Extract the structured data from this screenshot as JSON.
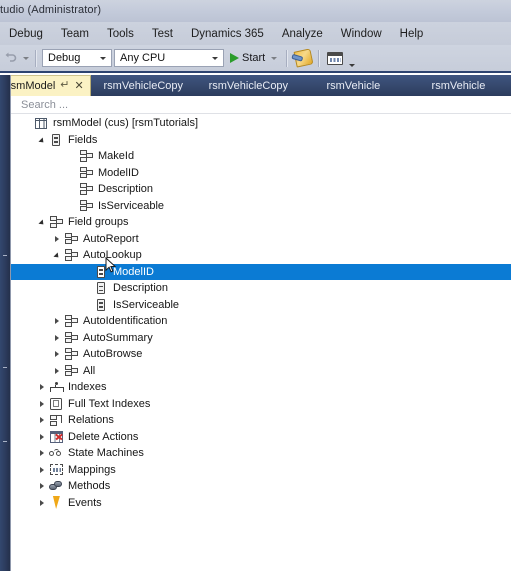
{
  "window": {
    "title": "tudio  (Administrator)"
  },
  "menubar": {
    "items": [
      {
        "label": "Debug"
      },
      {
        "label": "Team"
      },
      {
        "label": "Tools"
      },
      {
        "label": "Test"
      },
      {
        "label": "Dynamics 365"
      },
      {
        "label": "Analyze"
      },
      {
        "label": "Window"
      },
      {
        "label": "Help"
      }
    ]
  },
  "toolbar": {
    "undo_icon": "undo-icon",
    "undo_dropdown_icon": "chevron-down-icon",
    "config_combo": {
      "value": "Debug",
      "dropdown_icon": "chevron-down-icon"
    },
    "platform_combo": {
      "value": "Any CPU",
      "dropdown_icon": "chevron-down-icon"
    },
    "start_button": {
      "label": "Start",
      "play_icon": "play-icon",
      "dropdown_icon": "chevron-down-icon"
    },
    "attach_icon": "attach-to-process-icon",
    "window_icon": "window-layout-icon",
    "overflow_icon": "toolbar-overflow-icon"
  },
  "tabs": [
    {
      "label": "rsmModel",
      "active": true,
      "pin_icon": "pin-icon",
      "close_icon": "close-icon"
    },
    {
      "label": "rsmVehicleCopy",
      "active": false
    },
    {
      "label": "rsmVehicleCopy",
      "active": false
    },
    {
      "label": "rsmVehicle",
      "active": false
    },
    {
      "label": "rsmVehicle",
      "active": false
    }
  ],
  "search": {
    "placeholder": "Search ...",
    "value": ""
  },
  "tree": [
    {
      "label": "rsmModel (cus) [rsmTutorials]",
      "indent": 0,
      "expander": "none",
      "icon": "table-icon",
      "selected": false
    },
    {
      "label": "Fields",
      "indent": 1,
      "expander": "expanded",
      "icon": "field-icon",
      "selected": false
    },
    {
      "label": "MakeId",
      "indent": 3,
      "expander": "none",
      "icon": "field-group-icon",
      "selected": false
    },
    {
      "label": "ModelID",
      "indent": 3,
      "expander": "none",
      "icon": "field-group-icon",
      "selected": false
    },
    {
      "label": "Description",
      "indent": 3,
      "expander": "none",
      "icon": "field-group-icon",
      "selected": false
    },
    {
      "label": "IsServiceable",
      "indent": 3,
      "expander": "none",
      "icon": "field-group-icon",
      "selected": false
    },
    {
      "label": "Field groups",
      "indent": 1,
      "expander": "expanded",
      "icon": "field-group-icon",
      "selected": false
    },
    {
      "label": "AutoReport",
      "indent": 2,
      "expander": "collapsed",
      "icon": "field-group-icon",
      "selected": false
    },
    {
      "label": "AutoLookup",
      "indent": 2,
      "expander": "expanded",
      "icon": "field-group-icon",
      "selected": false
    },
    {
      "label": "ModelID",
      "indent": 4,
      "expander": "none",
      "icon": "field-icon",
      "selected": true
    },
    {
      "label": "Description",
      "indent": 4,
      "expander": "none",
      "icon": "field-icon",
      "selected": false
    },
    {
      "label": "IsServiceable",
      "indent": 4,
      "expander": "none",
      "icon": "field-icon",
      "selected": false
    },
    {
      "label": "AutoIdentification",
      "indent": 2,
      "expander": "collapsed",
      "icon": "field-group-icon",
      "selected": false
    },
    {
      "label": "AutoSummary",
      "indent": 2,
      "expander": "collapsed",
      "icon": "field-group-icon",
      "selected": false
    },
    {
      "label": "AutoBrowse",
      "indent": 2,
      "expander": "collapsed",
      "icon": "field-group-icon",
      "selected": false
    },
    {
      "label": "All",
      "indent": 2,
      "expander": "collapsed",
      "icon": "field-group-icon",
      "selected": false
    },
    {
      "label": "Indexes",
      "indent": 1,
      "expander": "collapsed",
      "icon": "index-icon",
      "selected": false
    },
    {
      "label": "Full Text Indexes",
      "indent": 1,
      "expander": "collapsed",
      "icon": "full-text-index-icon",
      "selected": false
    },
    {
      "label": "Relations",
      "indent": 1,
      "expander": "collapsed",
      "icon": "relation-icon",
      "selected": false
    },
    {
      "label": "Delete Actions",
      "indent": 1,
      "expander": "collapsed",
      "icon": "delete-action-icon",
      "selected": false
    },
    {
      "label": "State Machines",
      "indent": 1,
      "expander": "collapsed",
      "icon": "state-machine-icon",
      "selected": false
    },
    {
      "label": "Mappings",
      "indent": 1,
      "expander": "collapsed",
      "icon": "mapping-icon",
      "selected": false
    },
    {
      "label": "Methods",
      "indent": 1,
      "expander": "collapsed",
      "icon": "method-icon",
      "selected": false
    },
    {
      "label": "Events",
      "indent": 1,
      "expander": "collapsed",
      "icon": "event-icon",
      "selected": false
    }
  ],
  "colors": {
    "selection": "#0b7bd4",
    "active_tab": "#fbf2c4",
    "tabstrip": "#36496e",
    "chrome": "#c8cedb"
  },
  "cursor": {
    "icon": "mouse-pointer-icon"
  }
}
